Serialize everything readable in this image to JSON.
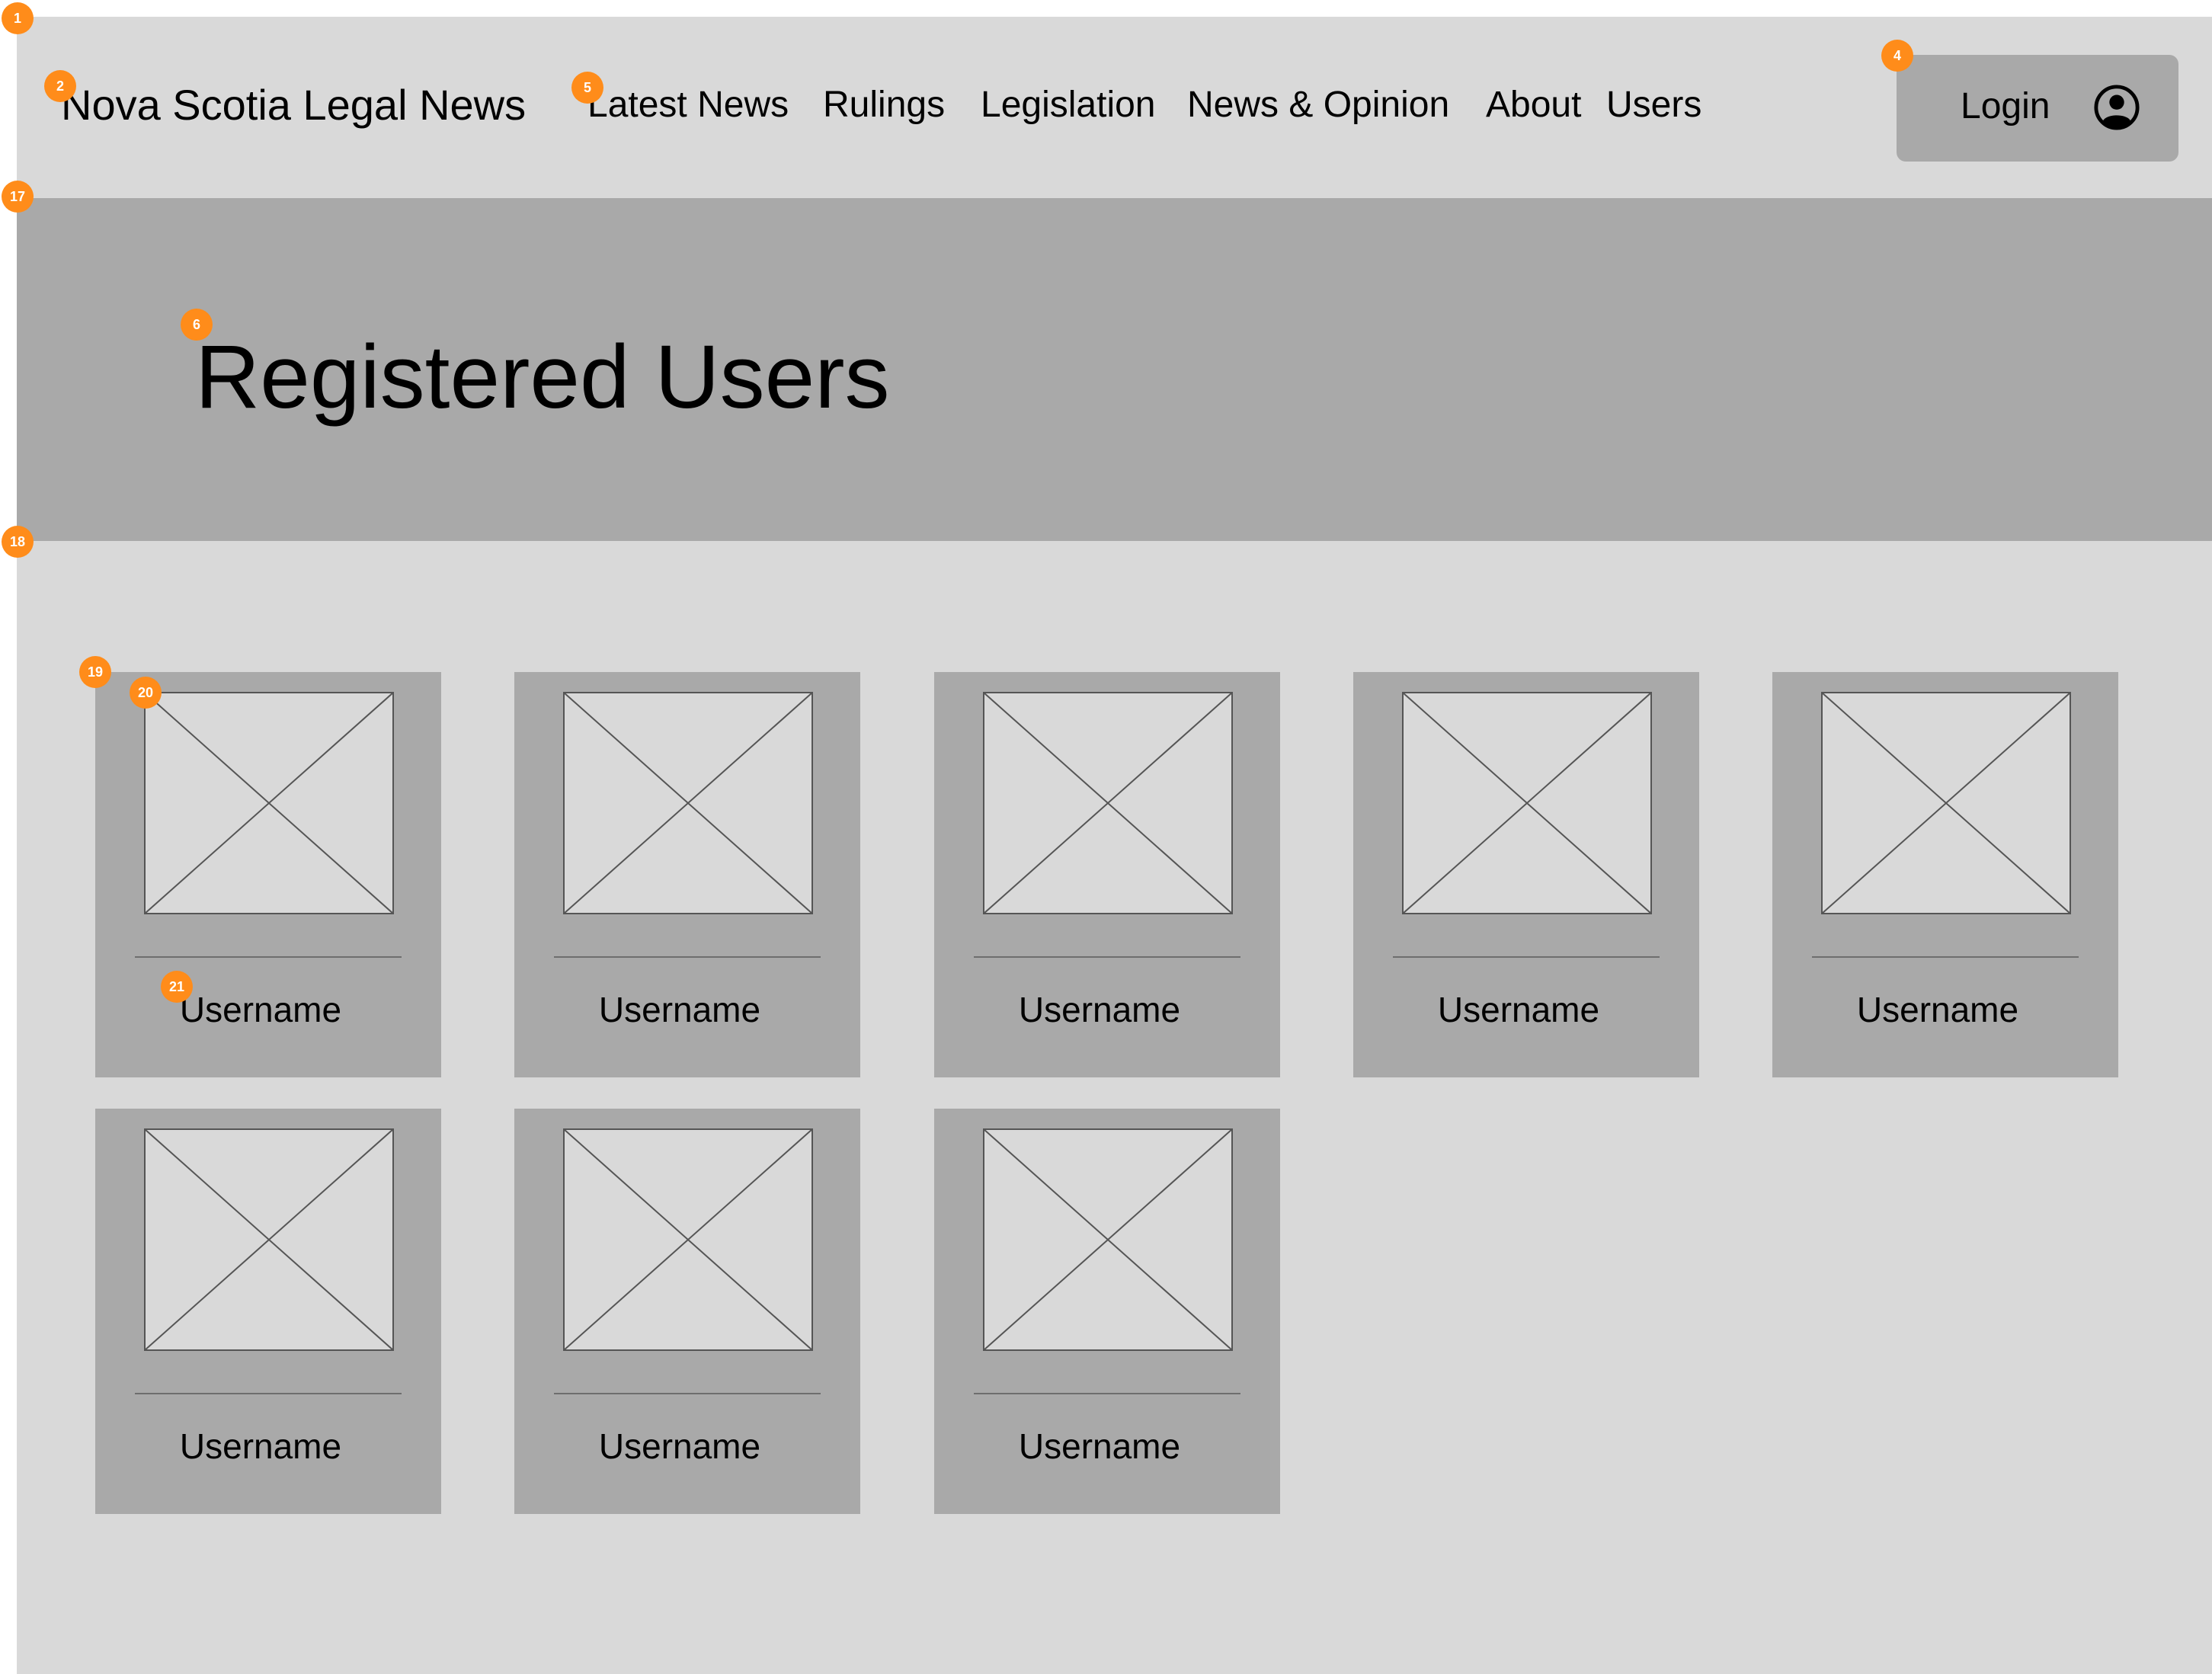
{
  "header": {
    "site_title": "Nova Scotia Legal News",
    "nav": [
      {
        "label": "Latest News"
      },
      {
        "label": "Rulings"
      },
      {
        "label": "Legislation"
      },
      {
        "label": "News & Opinion"
      },
      {
        "label": "About"
      },
      {
        "label": "Users"
      }
    ],
    "login_label": "Login",
    "login_icon": "user-circle-icon"
  },
  "banner": {
    "title": "Registered Users"
  },
  "users": [
    {
      "username": "Username",
      "avatar": "image-placeholder-icon"
    },
    {
      "username": "Username",
      "avatar": "image-placeholder-icon"
    },
    {
      "username": "Username",
      "avatar": "image-placeholder-icon"
    },
    {
      "username": "Username",
      "avatar": "image-placeholder-icon"
    },
    {
      "username": "Username",
      "avatar": "image-placeholder-icon"
    },
    {
      "username": "Username",
      "avatar": "image-placeholder-icon"
    },
    {
      "username": "Username",
      "avatar": "image-placeholder-icon"
    },
    {
      "username": "Username",
      "avatar": "image-placeholder-icon"
    }
  ],
  "annotations": {
    "page": "1",
    "site_title": "2",
    "login": "4",
    "nav": "5",
    "page_title": "6",
    "banner": "17",
    "users_area": "18",
    "user_card": "19",
    "avatar": "20",
    "username": "21"
  },
  "colors": {
    "page_bg": "#d9d9d9",
    "panel_bg": "#a9a9a9",
    "badge": "#ff8c1a"
  }
}
